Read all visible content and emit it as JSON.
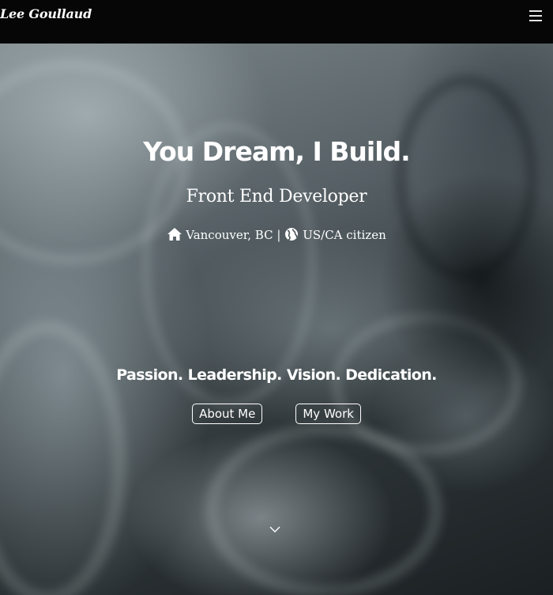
{
  "navbar": {
    "brand": "Lee Goullaud",
    "menu_icon": "hamburger-menu-icon"
  },
  "hero": {
    "headline": "You Dream, I Build.",
    "subtitle": "Front End Developer",
    "location": {
      "home_icon": "home-icon",
      "city": "Vancouver, BC",
      "separator": "|",
      "globe_icon": "globe-icon",
      "citizenship": "US/CA citizen"
    },
    "tagline": "Passion. Leadership. Vision. Dedication.",
    "buttons": {
      "about_label": "About Me",
      "work_label": "My Work"
    },
    "scroll_icon": "chevron-down-icon"
  },
  "colors": {
    "navbar_bg": "#060606",
    "text": "#ffffff",
    "button_border": "#ffffff"
  }
}
